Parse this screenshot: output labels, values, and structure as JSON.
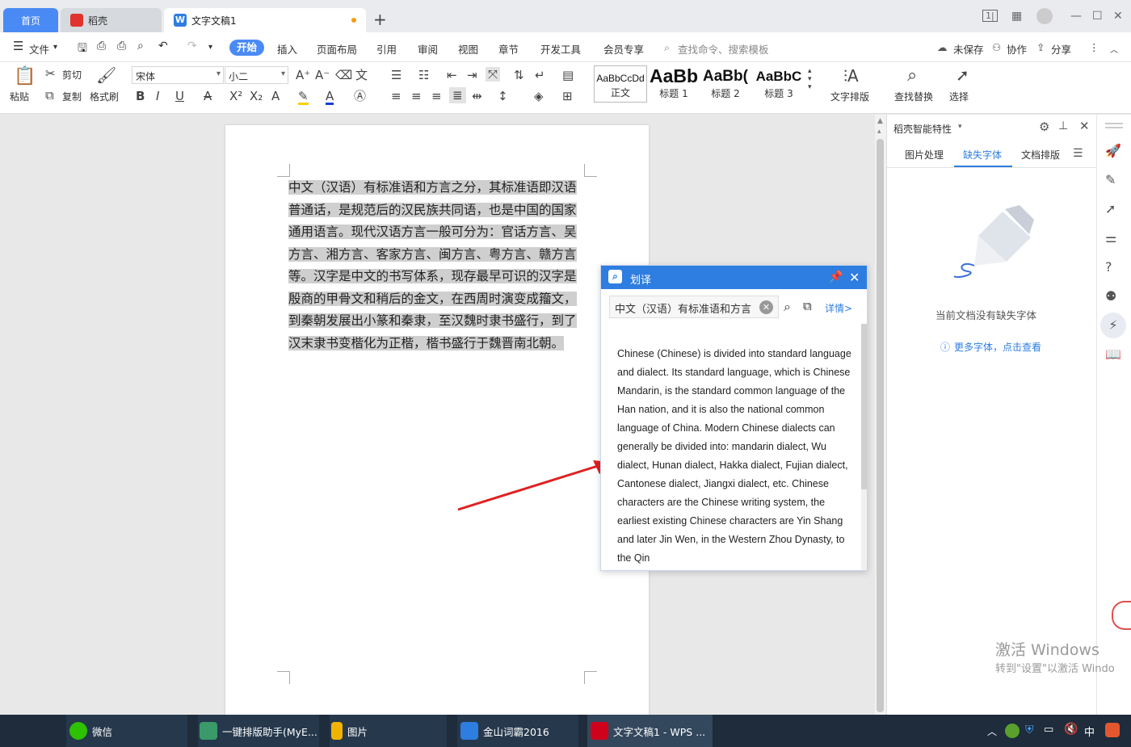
{
  "titlebar": {
    "tab_home": "首页",
    "tab_shell": "稻壳",
    "tab_doc": "文字文稿1",
    "new_tab": "+",
    "brand_color": "#4a8af4"
  },
  "menubar": {
    "file": "文件",
    "items": [
      "开始",
      "插入",
      "页面布局",
      "引用",
      "审阅",
      "视图",
      "章节",
      "开发工具",
      "会员专享"
    ],
    "search_placeholder": "查找命令、搜索模板",
    "unsaved": "未保存",
    "collaborate": "协作",
    "share": "分享"
  },
  "ribbon": {
    "paste": "粘贴",
    "cut": "剪切",
    "copy": "复制",
    "format_painter": "格式刷",
    "font_name": "宋体",
    "font_size": "小二",
    "styles": [
      {
        "sample": "AaBbCcDd",
        "name": "正文"
      },
      {
        "sample": "AaBb",
        "name": "标题 1"
      },
      {
        "sample": "AaBb(",
        "name": "标题 2"
      },
      {
        "sample": "AaBbC",
        "name": "标题 3"
      }
    ],
    "text_layout": "文字排版",
    "find_replace": "查找替换",
    "select": "选择"
  },
  "document": {
    "text": "中文（汉语）有标准语和方言之分，其标准语即汉语普通话，是规范后的汉民族共同语，也是中国的国家通用语言。现代汉语方言一般可分为：官话方言、吴方言、湘方言、客家方言、闽方言、粤方言、赣方言等。汉字是中文的书写体系，现存最早可识的汉字是殷商的甲骨文和稍后的金文，在西周时演变成籀文，到秦朝发展出小篆和秦隶，至汉魏时隶书盛行，到了汉末隶书变楷化为正楷，楷书盛行于魏晋南北朝。"
  },
  "translate_popup": {
    "title": "划译",
    "query": "中文（汉语）有标准语和方言",
    "details": "详情>",
    "result": "Chinese (Chinese) is divided into standard language and dialect. Its standard language, which is Chinese Mandarin, is the standard common language of the Han nation, and it is also the national common language of China. Modern Chinese dialects can generally be divided into: mandarin dialect, Wu dialect, Hunan dialect, Hakka dialect, Fujian dialect, Cantonese dialect, Jiangxi dialect, etc. Chinese characters are the Chinese writing system, the earliest existing Chinese characters are Yin Shang and later Jin Wen, in the Western Zhou Dynasty, to the Qin"
  },
  "right_panel": {
    "title": "稻壳智能特性",
    "tabs": [
      "图片处理",
      "缺失字体",
      "文档排版"
    ],
    "active_tab": 1,
    "empty_text": "当前文档没有缺失字体",
    "more_link": "更多字体，点击查看"
  },
  "watermark": {
    "line1": "激活 Windows",
    "line2": "转到\"设置\"以激活 Windo"
  },
  "taskbar": {
    "items": [
      {
        "label": "微信",
        "color": "#2dc100"
      },
      {
        "label": "一键排版助手(MyE...",
        "color": "#3a9a6a"
      },
      {
        "label": "图片",
        "color": "#f0b400"
      },
      {
        "label": "金山词霸2016",
        "color": "#2e7de0"
      },
      {
        "label": "文字文稿1 - WPS ...",
        "color": "#d0021b"
      }
    ],
    "ime": "中"
  }
}
